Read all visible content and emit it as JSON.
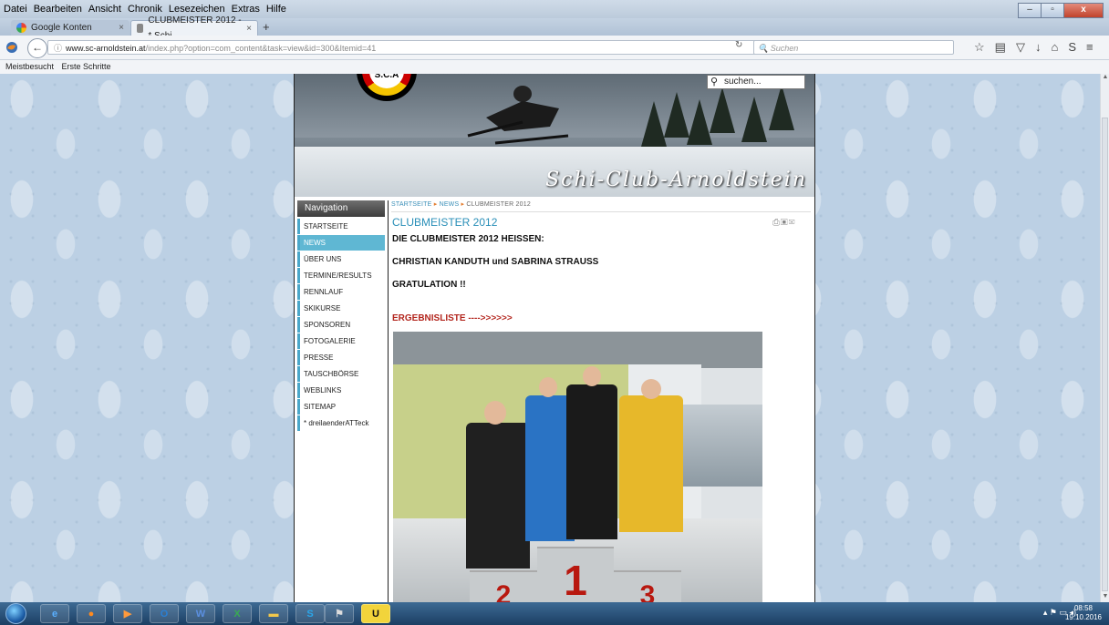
{
  "menu": [
    "Datei",
    "Bearbeiten",
    "Ansicht",
    "Chronik",
    "Lesezeichen",
    "Extras",
    "Hilfe"
  ],
  "tabs": [
    {
      "label": "Google Konten",
      "active": false
    },
    {
      "label": "CLUBMEISTER 2012 - * Schi...",
      "active": true
    }
  ],
  "url": {
    "host": "www.sc-arnoldstein.at",
    "path": "/index.php?option=com_content&task=view&id=300&Itemid=41"
  },
  "search_placeholder": "Suchen",
  "bookmarks": [
    "Meistbesucht",
    "Erste Schritte"
  ],
  "site": {
    "title": "Schi-Club-Arnoldstein",
    "badge_text": "S.C.A",
    "search_placeholder": "suchen...",
    "nav_title": "Navigation",
    "nav": [
      {
        "label": "STARTSEITE",
        "selected": false
      },
      {
        "label": "NEWS",
        "selected": true
      },
      {
        "label": "ÜBER UNS",
        "selected": false
      },
      {
        "label": "TERMINE/RESULTS",
        "selected": false
      },
      {
        "label": "RENNLAUF",
        "selected": false
      },
      {
        "label": "SKIKURSE",
        "selected": false
      },
      {
        "label": "SPONSOREN",
        "selected": false
      },
      {
        "label": "FOTOGALERIE",
        "selected": false
      },
      {
        "label": "PRESSE",
        "selected": false
      },
      {
        "label": "TAUSCHBÖRSE",
        "selected": false
      },
      {
        "label": "WEBLINKS",
        "selected": false
      },
      {
        "label": "SITEMAP",
        "selected": false
      },
      {
        "label": "* dreilaenderATTeck",
        "selected": false
      }
    ],
    "breadcrumb": [
      "STARTSEITE",
      "NEWS",
      "CLUBMEISTER 2012"
    ],
    "article": {
      "title": "CLUBMEISTER 2012",
      "line1": "DIE CLUBMEISTER 2012 HEISSEN:",
      "line2": "CHRISTIAN KANDUTH und SABRINA STRAUSS",
      "line3": "GRATULATION !!",
      "link": "ERGEBNISLISTE ---->>>>>>"
    },
    "photo_podium": [
      "2",
      "1",
      "3"
    ]
  },
  "taskbar": {
    "time": "08:58",
    "date": "19.10.2016"
  }
}
